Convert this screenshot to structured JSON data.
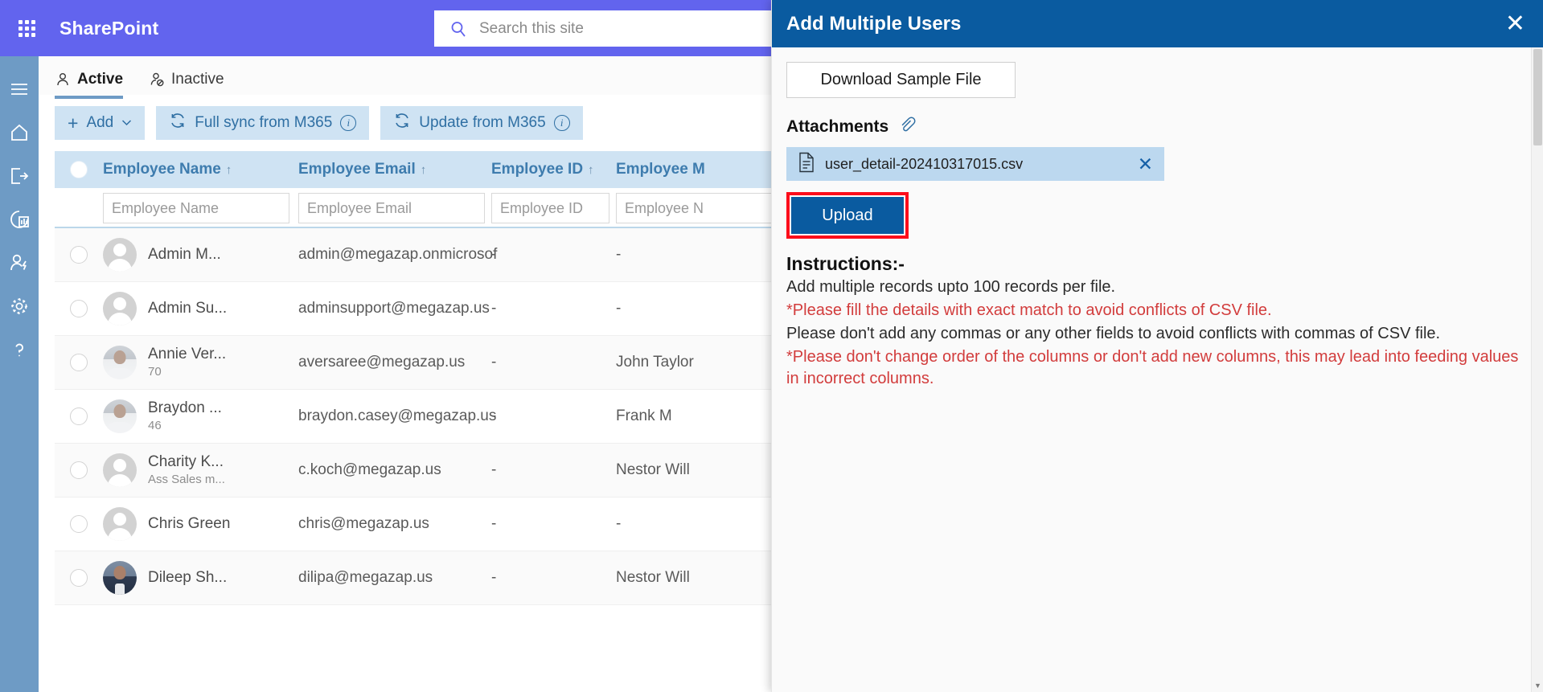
{
  "suite": {
    "waffle_icon": "app-launcher-icon",
    "brand": "SharePoint",
    "search_icon": "search-icon",
    "search_placeholder": "Search this site"
  },
  "rail": {
    "items": [
      {
        "icon": "hamburger-menu-icon",
        "name": "menu"
      },
      {
        "icon": "home-icon",
        "name": "home"
      },
      {
        "icon": "sign-out-icon",
        "name": "sign-out"
      },
      {
        "icon": "analytics-icon",
        "name": "analytics"
      },
      {
        "icon": "user-power-icon",
        "name": "user-admin"
      },
      {
        "icon": "gear-icon",
        "name": "settings"
      },
      {
        "icon": "help-icon",
        "name": "help"
      }
    ]
  },
  "tabs": [
    {
      "label": "Active",
      "icon": "person-icon",
      "active": true
    },
    {
      "label": "Inactive",
      "icon": "person-blocked-icon",
      "active": false
    }
  ],
  "toolbar": {
    "add_label": "Add",
    "add_plus": "+",
    "add_caret": "⌄",
    "full_sync_label": "Full sync from M365",
    "update_label": "Update from M365",
    "info_glyph": "i",
    "refresh_icon": "refresh-icon"
  },
  "table": {
    "sort_arrow": "↑",
    "columns": [
      {
        "key": "name",
        "header": "Employee Name",
        "sorted": true,
        "placeholder": "Employee Name"
      },
      {
        "key": "email",
        "header": "Employee Email",
        "sorted": true,
        "placeholder": "Employee Email"
      },
      {
        "key": "id",
        "header": "Employee ID",
        "sorted": true,
        "placeholder": "Employee ID"
      },
      {
        "key": "mgr",
        "header": "Employee M",
        "sorted": false,
        "placeholder": "Employee N"
      }
    ],
    "rows": [
      {
        "name": "Admin M...",
        "sub": "",
        "email": "admin@megazap.onmicrosof",
        "id": "-",
        "mgr": "-",
        "avatar": "generic"
      },
      {
        "name": "Admin Su...",
        "sub": "",
        "email": "adminsupport@megazap.us",
        "id": "-",
        "mgr": "-",
        "avatar": "generic"
      },
      {
        "name": "Annie Ver...",
        "sub": "70",
        "email": "aversaree@megazap.us",
        "id": "-",
        "mgr": "John Taylor",
        "avatar": "female"
      },
      {
        "name": "Braydon ...",
        "sub": "46",
        "email": "braydon.casey@megazap.us",
        "id": "-",
        "mgr": "Frank M",
        "avatar": "female"
      },
      {
        "name": "Charity K...",
        "sub": "Ass Sales m...",
        "email": "c.koch@megazap.us",
        "id": "-",
        "mgr": "Nestor Will",
        "avatar": "generic"
      },
      {
        "name": "Chris Green",
        "sub": "",
        "email": "chris@megazap.us",
        "id": "-",
        "mgr": "-",
        "avatar": "generic"
      },
      {
        "name": "Dileep Sh...",
        "sub": "",
        "email": "dilipa@megazap.us",
        "id": "-",
        "mgr": "Nestor Will",
        "avatar": "male"
      }
    ]
  },
  "panel": {
    "title": "Add Multiple Users",
    "close_icon": "close-icon",
    "download_sample_label": "Download Sample File",
    "attachments_label": "Attachments",
    "attachment_icon": "paperclip-icon",
    "file": {
      "icon": "file-document-icon",
      "name": "user_detail-202410317015.csv",
      "remove_icon": "close-icon"
    },
    "upload_label": "Upload",
    "highlight_color": "#fc0d1b",
    "accent_color": "#0a5ba0",
    "instructions_title": "Instructions:-",
    "instructions": [
      {
        "text": "Add multiple records upto 100 records per file.",
        "warn": false
      },
      {
        "text": "*Please fill the details with exact match to avoid conflicts of CSV file.",
        "warn": true
      },
      {
        "text": "Please don't add any commas or any other fields to avoid conflicts with commas of CSV file.",
        "warn": false
      },
      {
        "text": "*Please don't change order of the columns or don't add new columns, this may lead into feeding values in incorrect columns.",
        "warn": true
      }
    ],
    "scrollbar": {
      "up": "▲",
      "down": "▼"
    }
  }
}
